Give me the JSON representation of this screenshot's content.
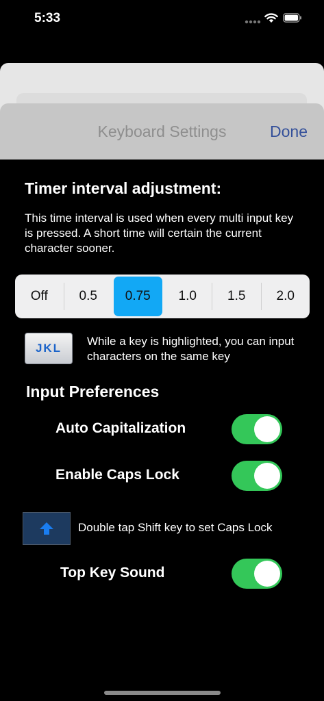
{
  "status": {
    "time": "5:33"
  },
  "header": {
    "title": "Keyboard Settings",
    "done_label": "Done"
  },
  "timer": {
    "heading": "Timer interval adjustment:",
    "description": "This time interval is used when every multi input key is pressed. A short time will certain the current character sooner.",
    "options": [
      "Off",
      "0.5",
      "0.75",
      "1.0",
      "1.5",
      "2.0"
    ],
    "selected": "0.75"
  },
  "jkl": {
    "key_label": "JKL",
    "text": "While a key is highlighted, you can input characters on the same key"
  },
  "prefs": {
    "heading": "Input Preferences",
    "auto_cap": {
      "label": "Auto Capitalization",
      "on": true
    },
    "caps_lock": {
      "label": "Enable Caps Lock",
      "on": true
    },
    "shift_text": "Double tap Shift key to set Caps Lock",
    "top_key_sound": {
      "label": "Top Key Sound",
      "on": true
    }
  },
  "colors": {
    "accent": "#12a8f5",
    "toggle_on": "#34c759",
    "done": "#34509a"
  }
}
